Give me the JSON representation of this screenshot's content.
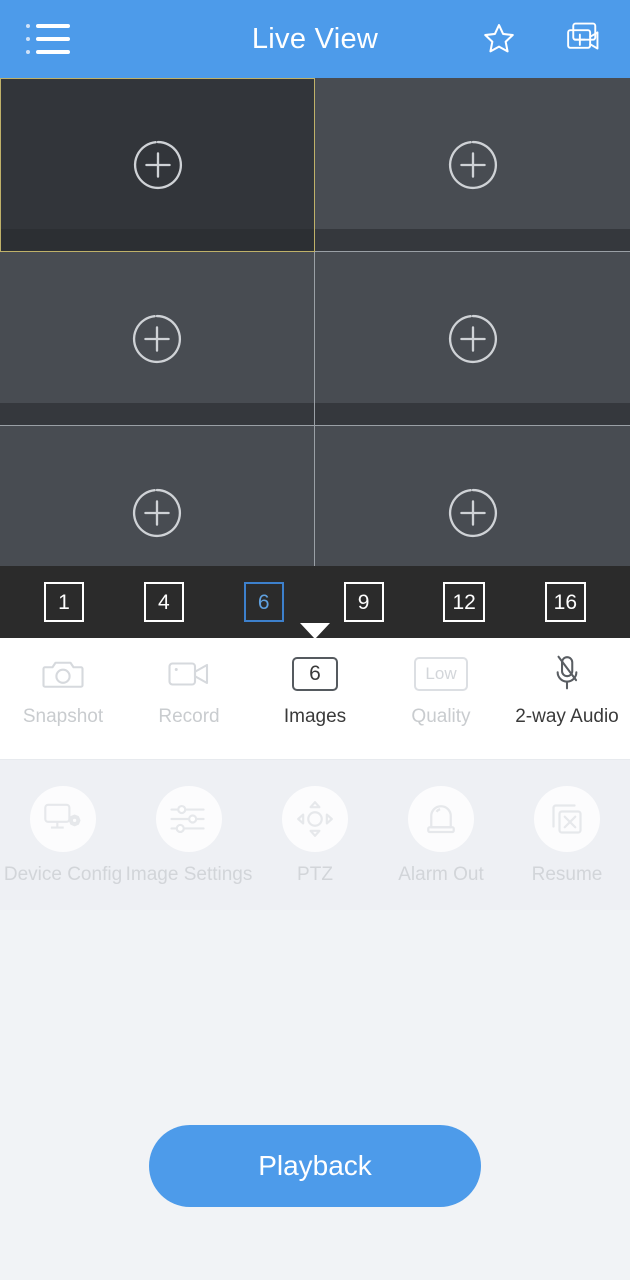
{
  "header": {
    "title": "Live View",
    "menu_icon": "list-menu-icon",
    "favorite_icon": "star-icon",
    "add_device_icon": "add-camera-icon"
  },
  "video_grid": {
    "layout": "6",
    "selected_cell_index": 0,
    "cells": [
      {
        "index": 0,
        "state": "empty",
        "add_icon": "plus-circle-icon",
        "selected": true
      },
      {
        "index": 1,
        "state": "empty",
        "add_icon": "plus-circle-icon",
        "selected": false
      },
      {
        "index": 2,
        "state": "empty",
        "add_icon": "plus-circle-icon",
        "selected": false
      },
      {
        "index": 3,
        "state": "empty",
        "add_icon": "plus-circle-icon",
        "selected": false
      },
      {
        "index": 4,
        "state": "empty",
        "add_icon": "plus-circle-icon",
        "selected": false
      },
      {
        "index": 5,
        "state": "empty",
        "add_icon": "plus-circle-icon",
        "selected": false
      }
    ]
  },
  "layout_selector": {
    "options": [
      {
        "label": "1",
        "active": false
      },
      {
        "label": "4",
        "active": false
      },
      {
        "label": "6",
        "active": true
      },
      {
        "label": "9",
        "active": false
      },
      {
        "label": "12",
        "active": false
      },
      {
        "label": "16",
        "active": false
      }
    ],
    "active_value": "6"
  },
  "toolbar_primary": [
    {
      "label": "Snapshot",
      "icon": "camera-icon",
      "enabled": false,
      "badge": ""
    },
    {
      "label": "Record",
      "icon": "video-camera-icon",
      "enabled": false,
      "badge": ""
    },
    {
      "label": "Images",
      "icon": "images-count-box",
      "enabled": true,
      "badge": "6"
    },
    {
      "label": "Quality",
      "icon": "quality-box",
      "enabled": false,
      "badge": "Low"
    },
    {
      "label": "2-way Audio",
      "icon": "microphone-muted-icon",
      "enabled": true,
      "badge": ""
    }
  ],
  "toolbar_secondary": [
    {
      "label": "Device Config",
      "icon": "monitor-gear-icon",
      "enabled": false
    },
    {
      "label": "Image Settings",
      "icon": "sliders-icon",
      "enabled": false
    },
    {
      "label": "PTZ",
      "icon": "ptz-directional-icon",
      "enabled": false
    },
    {
      "label": "Alarm Out",
      "icon": "siren-icon",
      "enabled": false
    },
    {
      "label": "Resume",
      "icon": "stacked-squares-x-icon",
      "enabled": false
    }
  ],
  "footer": {
    "playback_label": "Playback"
  },
  "colors": {
    "brand_blue": "#4d9bea",
    "accent_blue": "#5fa1e0",
    "selected_cell_border": "#bfb169",
    "grid_cell_bg": "#484c52",
    "layout_bar_bg": "#2b2b2b",
    "panel_bg": "#eef0f4",
    "page_bg": "#f1f3f6",
    "disabled_text": "#c9cccf"
  }
}
